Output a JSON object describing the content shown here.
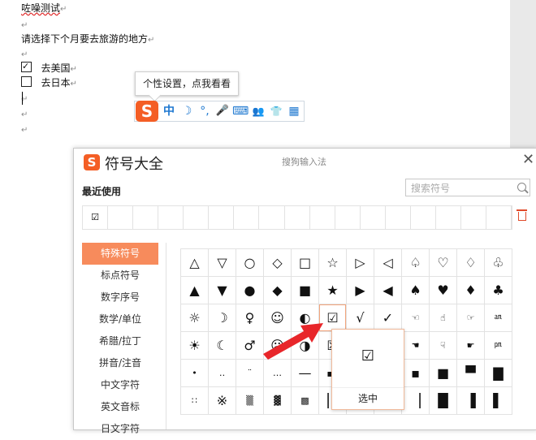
{
  "document": {
    "lines": [
      "咗噪测试",
      "",
      "请选择下个月要去旅游的地方",
      "",
      "去美国",
      "去日本",
      "",
      "",
      ""
    ],
    "para_mark": "↵"
  },
  "tooltip": {
    "text": "个性设置，点我看看"
  },
  "ime_bar": {
    "logo": "S",
    "items": [
      "中",
      "☽",
      "°,",
      "🎤",
      "⌨",
      "👥",
      "👕",
      "▦"
    ],
    "icons": [
      "chinese-mode-icon",
      "moon-icon",
      "punctuation-icon",
      "microphone-icon",
      "keyboard-icon",
      "user-icon",
      "skin-icon",
      "toolbox-icon"
    ]
  },
  "panel": {
    "logo": "S",
    "title": "符号大全",
    "subtitle": "搜狗输入法",
    "close": "✕",
    "recent_title": "最近使用",
    "search_placeholder": "搜索符号",
    "recent": [
      "☑",
      "",
      "",
      "",
      "",
      "",
      "",
      "",
      "",
      "",
      "",
      "",
      "",
      "",
      "",
      "",
      ""
    ],
    "categories": [
      "特殊符号",
      "标点符号",
      "数字序号",
      "数学/单位",
      "希腊/拉丁",
      "拼音/注音",
      "中文字符",
      "英文音标",
      "日文字符"
    ],
    "active_category": 0,
    "symbols": [
      [
        "△",
        "▽",
        "○",
        "◇",
        "□",
        "☆",
        "▷",
        "◁",
        "♤",
        "♡",
        "♢",
        "♧"
      ],
      [
        "▲",
        "▼",
        "●",
        "◆",
        "■",
        "★",
        "▶",
        "◀",
        "♠",
        "♥",
        "♦",
        "♣"
      ],
      [
        "☼",
        "☽",
        "♀",
        "☺",
        "◐",
        "☑",
        "√",
        "✓",
        "☜",
        "☝",
        "☞",
        "㏂"
      ],
      [
        "☀",
        "☾",
        "♂",
        "☹",
        "◑",
        "☒",
        "",
        "",
        "☚",
        "☟",
        "☛",
        "㏘"
      ],
      [
        "•",
        "‥",
        "¨",
        "…",
        "—",
        "▬",
        "",
        "",
        "▪",
        "■",
        "▀",
        "▇"
      ],
      [
        "∷",
        "※",
        "▒",
        "▓",
        "▩",
        "▏",
        "",
        "",
        "▕",
        "█",
        "▐",
        "▌"
      ]
    ],
    "popup": {
      "glyph": "☑",
      "label": "选中"
    }
  }
}
